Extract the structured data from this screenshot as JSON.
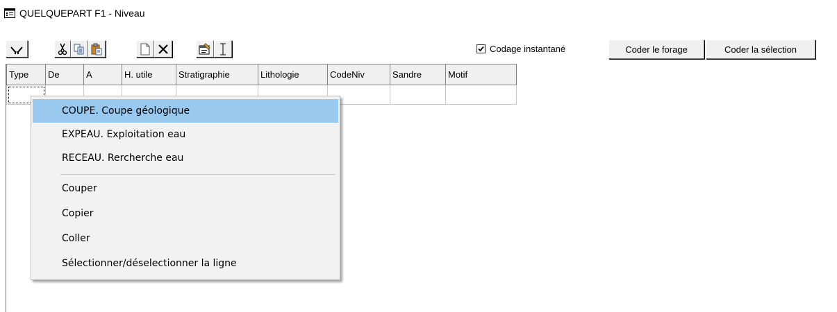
{
  "window": {
    "title": "QUELQUEPART F1 - Niveau",
    "icon": "form-window-icon"
  },
  "toolbar": {
    "icons": [
      "filter-icon",
      "cut-icon",
      "copy-icon",
      "paste-icon",
      "new-document-icon",
      "delete-icon",
      "properties-icon",
      "text-cursor-icon"
    ],
    "checkbox_label": "Codage instantané",
    "checkbox_checked": true,
    "coder_forage_label": "Coder le forage",
    "coder_selection_label": "Coder la sélection"
  },
  "grid": {
    "columns": [
      "Type",
      "De",
      "A",
      "H. utile",
      "Stratigraphie",
      "Lithologie",
      "CodeNiv",
      "Sandre",
      "Motif"
    ],
    "rows": [
      [
        "",
        "",
        "",
        "",
        "",
        "",
        "",
        "",
        ""
      ]
    ]
  },
  "context_menu": {
    "items": [
      {
        "label": "COUPE. Coupe géologique",
        "highlighted": true
      },
      {
        "label": "EXPEAU. Exploitation eau"
      },
      {
        "label": "RECEAU. Rercherche eau"
      },
      {
        "separator": true
      },
      {
        "label": "Couper"
      },
      {
        "label": "Copier"
      },
      {
        "label": "Coller"
      },
      {
        "label": "Sélectionner/déselectionner la ligne"
      }
    ]
  },
  "colors": {
    "menu_highlight": "#99c9ef",
    "button_face": "#f0f0f0"
  }
}
